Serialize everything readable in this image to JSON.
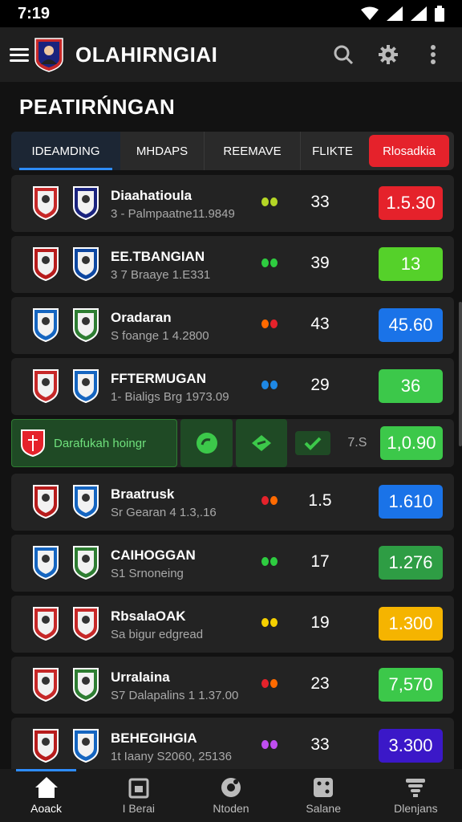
{
  "status": {
    "time": "7:19"
  },
  "app": {
    "title": "OLAHIRNGIAI"
  },
  "section": {
    "title": "PEATIRŃNGAN"
  },
  "tabs": [
    {
      "label": "IDEAMDING",
      "active": true
    },
    {
      "label": "MHDAPS"
    },
    {
      "label": "REEMAVE"
    },
    {
      "label": "FLIKTE"
    },
    {
      "label": "Rlosadkia",
      "live": true
    }
  ],
  "matches": [
    {
      "name": "Diaahatioula",
      "sub": "3 - Palmpaatne11.9849",
      "dots": [
        "#b5d626",
        "#b5d626"
      ],
      "score": "33",
      "odds": "1.5.30",
      "odds_color": "#e5222b"
    },
    {
      "name": "EE.TBANGIAN",
      "sub": "3 7 Braaye 1.E331",
      "dots": [
        "#2ecc40",
        "#2ecc40"
      ],
      "score": "39",
      "odds": "13",
      "odds_color": "#55d12a"
    },
    {
      "name": "Oradaran",
      "sub": "S foange 1 4.2800",
      "dots": [
        "#ff6a00",
        "#e5222b"
      ],
      "score": "43",
      "odds": "45.60",
      "odds_color": "#1a73e8"
    },
    {
      "name": "FFTERMUGAN",
      "sub": "1- Bialigs Brg 1973.09",
      "dots": [
        "#1e88e5",
        "#1e88e5"
      ],
      "score": "29",
      "odds": "36",
      "odds_color": "#3cc84a"
    },
    {
      "name": "Braatrusk",
      "sub": "Sr Gearan 4 1.3,.16",
      "dots": [
        "#e5222b",
        "#ff6a00"
      ],
      "score": "1.5",
      "odds": "1.610",
      "odds_color": "#1a73e8"
    },
    {
      "name": "CAIHOGGAN",
      "sub": "S1 Srnoneing",
      "dots": [
        "#2ecc40",
        "#2ecc40"
      ],
      "score": "17",
      "odds": "1.276",
      "odds_color": "#2e9d44"
    },
    {
      "name": "RbsalaOAK",
      "sub": "Sa bigur edgread",
      "dots": [
        "#f5d000",
        "#f5d000"
      ],
      "score": "19",
      "odds": "1.300",
      "odds_color": "#f5b400"
    },
    {
      "name": "Urralaina",
      "sub": "S7 Dalapalins 1 1.37.00",
      "dots": [
        "#e5222b",
        "#ff6a00"
      ],
      "score": "23",
      "odds": "7,570",
      "odds_color": "#3cc84a"
    },
    {
      "name": "BEHEGIHGIA",
      "sub": "1t Iaany S2060, 25136",
      "dots": [
        "#c04ef0",
        "#c04ef0"
      ],
      "score": "33",
      "odds": "3.300",
      "odds_color": "#3b18c8"
    }
  ],
  "promo": {
    "label": "Darafukah hoingr",
    "score": "7.S",
    "odds": "1,0.90"
  },
  "nav": [
    {
      "label": "Aoack",
      "icon": "home-icon",
      "active": true
    },
    {
      "label": "I Berai",
      "icon": "calendar-icon"
    },
    {
      "label": "Ntoden",
      "icon": "ball-icon"
    },
    {
      "label": "Salane",
      "icon": "dice-icon"
    },
    {
      "label": "Dlenjans",
      "icon": "trophy-icon"
    }
  ],
  "colors": {
    "accent": "#2d8cff",
    "live": "#e5222b",
    "promo": "#1f4a25"
  }
}
